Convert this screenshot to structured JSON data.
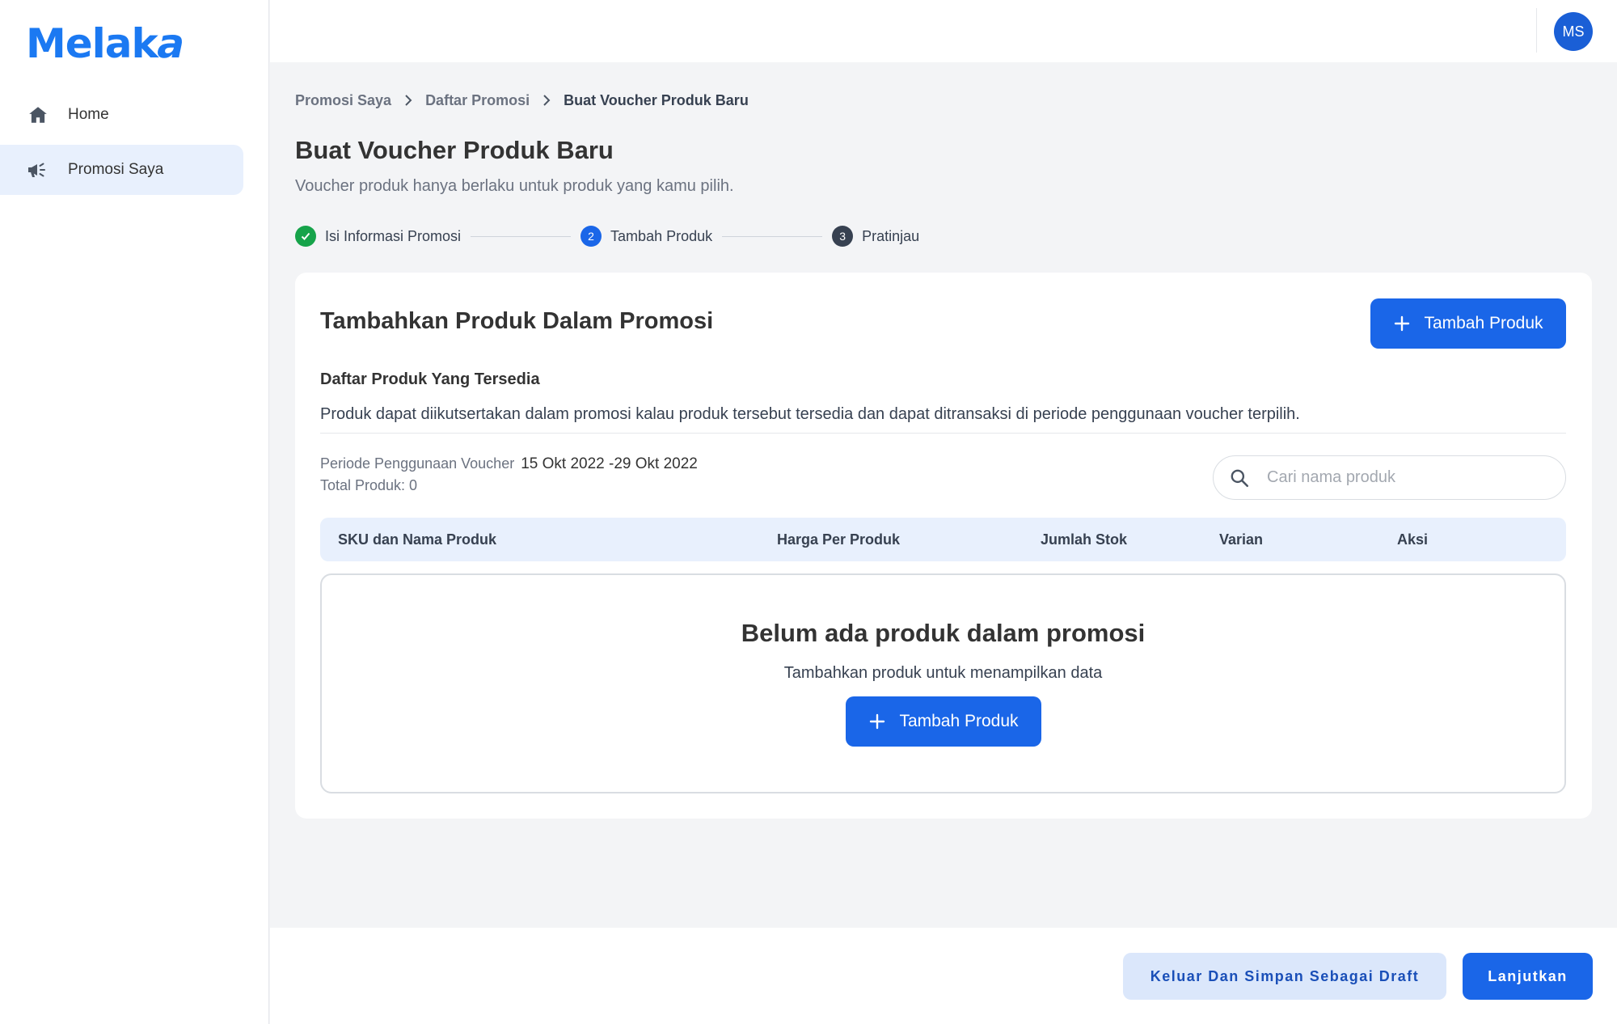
{
  "app": {
    "logo_text": "Melak",
    "logo_accent": "a",
    "brand_color": "#1b79f2"
  },
  "sidebar": {
    "items": [
      {
        "label": "Home",
        "icon": "home-icon",
        "active": false
      },
      {
        "label": "Promosi Saya",
        "icon": "megaphone-icon",
        "active": true
      }
    ]
  },
  "topbar": {
    "avatar_initials": "MS",
    "avatar_color": "#1a5fd6"
  },
  "breadcrumb": [
    "Promosi Saya",
    "Daftar Promosi",
    "Buat Voucher Produk Baru"
  ],
  "page": {
    "title": "Buat Voucher Produk Baru",
    "subtitle": "Voucher produk hanya berlaku untuk produk yang kamu pilih."
  },
  "stepper": [
    {
      "number": "1",
      "label": "Isi Informasi Promosi",
      "status": "done"
    },
    {
      "number": "2",
      "label": "Tambah Produk",
      "status": "active"
    },
    {
      "number": "3",
      "label": "Pratinjau",
      "status": "pending"
    }
  ],
  "card": {
    "title": "Tambahkan Produk Dalam Promosi",
    "add_button_label": "Tambah Produk",
    "section_title": "Daftar Produk Yang Tersedia",
    "section_desc": "Produk dapat diikutsertakan dalam promosi kalau produk tersebut tersedia dan dapat ditransaksi di periode penggunaan voucher terpilih.",
    "period_label": "Periode Penggunaan Voucher",
    "period_value": "15 Okt 2022 -29 Okt 2022",
    "total_label": "Total Produk: 0",
    "search": {
      "placeholder": "Cari nama produk",
      "value": ""
    },
    "table_headers": [
      "SKU dan Nama Produk",
      "Harga Per Produk",
      "Jumlah Stok",
      "Varian",
      "Aksi"
    ],
    "empty": {
      "title": "Belum ada produk dalam promosi",
      "desc": "Tambahkan produk untuk menampilkan data",
      "button_label": "Tambah Produk"
    }
  },
  "footer": {
    "secondary_label": "Keluar Dan Simpan Sebagai Draft",
    "primary_label": "Lanjutkan"
  },
  "colors": {
    "primary": "#1a66e8",
    "success": "#16a34a",
    "secondary_bg": "#dbe7fb"
  }
}
